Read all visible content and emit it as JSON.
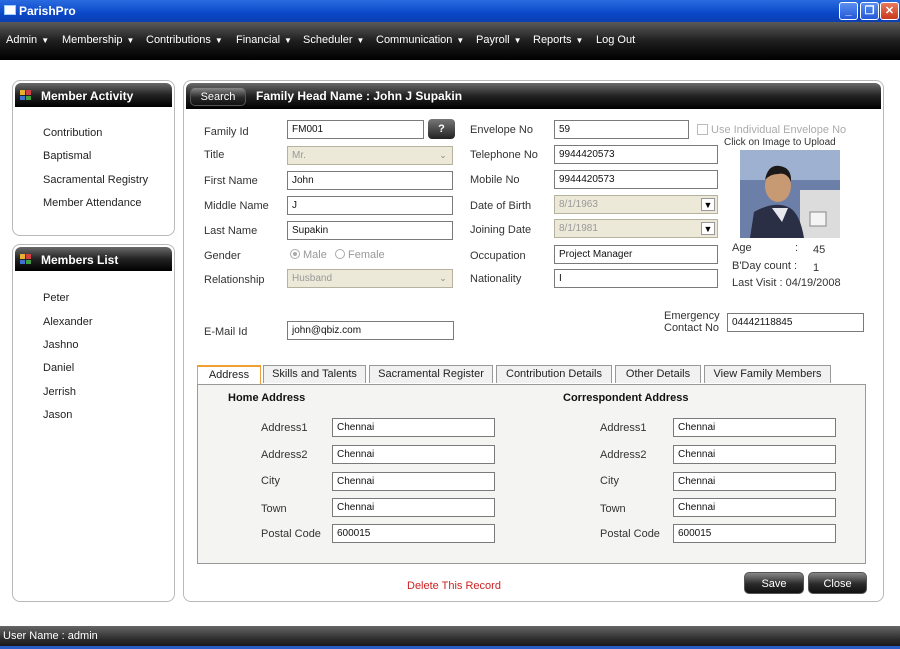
{
  "window": {
    "title": "ParishPro",
    "controls": [
      "minimize-icon",
      "restore-icon",
      "close-icon"
    ]
  },
  "menu": [
    {
      "label": "Admin"
    },
    {
      "label": "Membership"
    },
    {
      "label": "Contributions"
    },
    {
      "label": "Financial"
    },
    {
      "label": "Scheduler"
    },
    {
      "label": "Communication"
    },
    {
      "label": "Payroll"
    },
    {
      "label": "Reports"
    },
    {
      "label": "Log Out"
    }
  ],
  "member_activity": {
    "title": "Member Activity",
    "items": [
      "Contribution",
      "Baptismal",
      "Sacramental Registry",
      "Member Attendance"
    ]
  },
  "members_list": {
    "title": "Members List",
    "items": [
      "Peter",
      "Alexander",
      "Jashno",
      "Daniel",
      "Jerrish",
      "Jason"
    ]
  },
  "header": {
    "search_label": "Search",
    "family_head": "Family Head Name : John J Supakin"
  },
  "form": {
    "family_id": {
      "label": "Family Id",
      "value": "FM001",
      "help": "?"
    },
    "title": {
      "label": "Title",
      "value": "Mr."
    },
    "first_name": {
      "label": "First Name",
      "value": "John"
    },
    "middle_name": {
      "label": "Middle Name",
      "value": "J"
    },
    "last_name": {
      "label": "Last Name",
      "value": "Supakin"
    },
    "gender": {
      "label": "Gender",
      "options": [
        "Male",
        "Female"
      ],
      "selected": "Male"
    },
    "relationship": {
      "label": "Relationship",
      "value": "Husband"
    },
    "email": {
      "label": "E-Mail Id",
      "value": "john@qbiz.com"
    },
    "envelope_no": {
      "label": "Envelope No",
      "value": "59"
    },
    "use_individual_envelope": {
      "label": "Use Individual Envelope No",
      "checked": false
    },
    "telephone_no": {
      "label": "Telephone No",
      "value": "9944420573"
    },
    "mobile_no": {
      "label": "Mobile No",
      "value": "9944420573"
    },
    "date_of_birth": {
      "label": "Date of Birth",
      "value": "8/1/1963"
    },
    "joining_date": {
      "label": "Joining Date",
      "value": "8/1/1981"
    },
    "occupation": {
      "label": "Occupation",
      "value": "Project Manager"
    },
    "nationality": {
      "label": "Nationality",
      "value": "I"
    },
    "emergency_contact": {
      "label_line1": "Emergency",
      "label_line2": "Contact No",
      "value": "04442118845"
    }
  },
  "photo": {
    "upload_hint": "Click on Image to Upload",
    "age_label": "Age",
    "age_sep": ":",
    "age_value": "45",
    "bday_label": "B'Day count :",
    "bday_value": "1",
    "last_visit": "Last Visit : 04/19/2008"
  },
  "tabs": [
    "Address",
    "Skills and Talents",
    "Sacramental Register",
    "Contribution Details",
    "Other Details",
    "View Family Members"
  ],
  "address": {
    "home_title": "Home Address",
    "corr_title": "Correspondent Address",
    "labels": [
      "Address1",
      "Address2",
      "City",
      "Town",
      "Postal Code"
    ],
    "home_values": [
      "Chennai",
      "Chennai",
      "Chennai",
      "Chennai",
      "600015"
    ],
    "corr_values": [
      "Chennai",
      "Chennai",
      "Chennai",
      "Chennai",
      "600015"
    ]
  },
  "actions": {
    "delete": "Delete This Record",
    "save": "Save",
    "close": "Close"
  },
  "status": {
    "user": "User Name : admin"
  },
  "colors": {
    "delete_link": "#cc2222",
    "title_bar": "#0a48c8",
    "active_tab_border": "#f0a030"
  }
}
